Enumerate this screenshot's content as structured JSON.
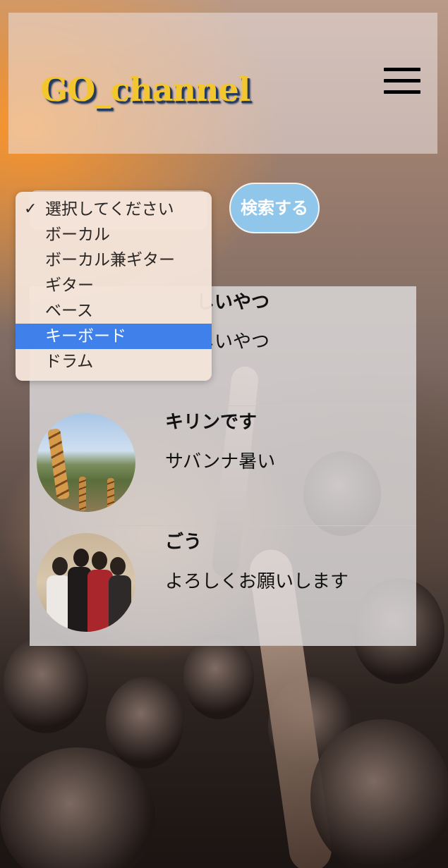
{
  "header": {
    "logo": "GO_channel",
    "menu_icon": "hamburger-menu-icon"
  },
  "search": {
    "button_label": "検索する",
    "select_value": "選択してください",
    "options": [
      {
        "label": "選択してください",
        "checked": true
      },
      {
        "label": "ボーカル"
      },
      {
        "label": "ボーカル兼ギター"
      },
      {
        "label": "ギター"
      },
      {
        "label": "ベース"
      },
      {
        "label": "キーボード",
        "highlighted": true
      },
      {
        "label": "ドラム"
      }
    ],
    "check_mark": "✓"
  },
  "members": [
    {
      "name": "しいやつ",
      "message": "しいやつ",
      "avatar": "hidden"
    },
    {
      "name": "キリンです",
      "message": "サバンナ暑い",
      "avatar": "giraffe-photo"
    },
    {
      "name": "ごう",
      "message": "よろしくお願いします",
      "avatar": "band-photo"
    }
  ],
  "colors": {
    "logo": "#f2c62c",
    "logo_shadow": "#243a5e",
    "button": "#8fc6ea",
    "highlight": "#3f80ea"
  }
}
